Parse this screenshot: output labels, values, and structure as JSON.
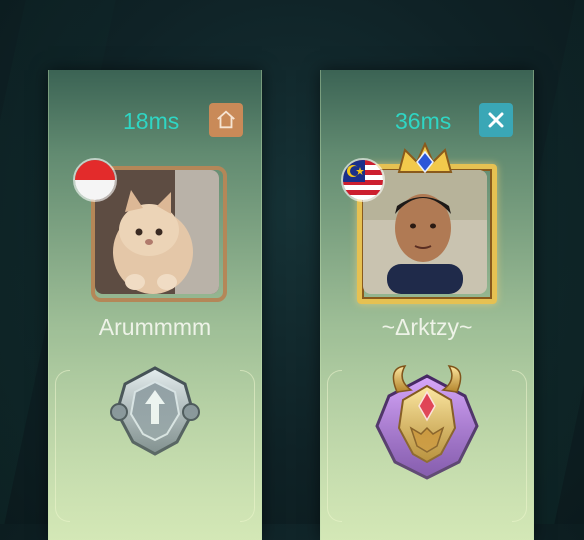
{
  "players": [
    {
      "ping": "18ms",
      "action_icon": "home-icon",
      "flag": "indonesia-flag-icon",
      "avatar": "cat-photo",
      "name": "Arummmm",
      "rank_emblem": "silver-rank-emblem"
    },
    {
      "ping": "36ms",
      "action_icon": "close-icon",
      "flag": "malaysia-flag-icon",
      "avatar": "person-photo",
      "name": "~Δrktzy~",
      "rank_emblem": "mythic-rank-emblem"
    }
  ],
  "colors": {
    "ping": "#2fd6c4",
    "home_button": "#c98a58",
    "close_button": "#3aa7b6",
    "gold_frame": "#e6c152"
  }
}
